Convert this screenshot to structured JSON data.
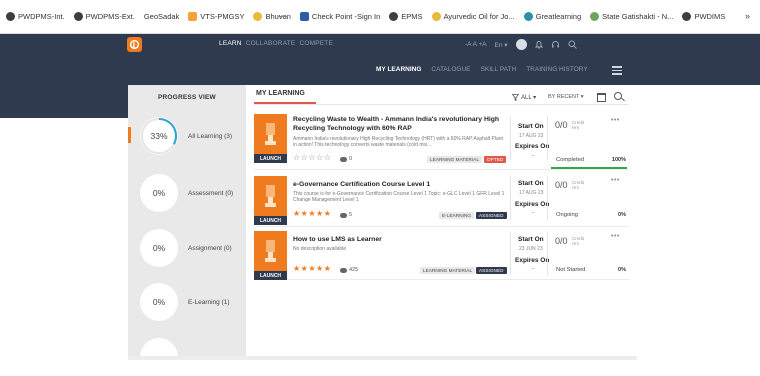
{
  "bookmarks": [
    {
      "label": "PWDPMS-Int.",
      "icon": "globe-icon"
    },
    {
      "label": "PWDPMS-Ext.",
      "icon": "globe-icon"
    },
    {
      "label": "GeoSadak",
      "icon": "dash-icon"
    },
    {
      "label": "VTS-PMGSY",
      "icon": "vts-icon"
    },
    {
      "label": "Bhuvan",
      "icon": "bhuvan-icon"
    },
    {
      "label": "Check Point -Sign In",
      "icon": "checkpoint-icon"
    },
    {
      "label": "EPMS",
      "icon": "globe-icon"
    },
    {
      "label": "Ayurvedic Oil for Jo...",
      "icon": "leaf-icon"
    },
    {
      "label": "Greatlearning",
      "icon": "g-icon"
    },
    {
      "label": "State Gatishakti - N...",
      "icon": "gatishakti-icon"
    },
    {
      "label": "PWDIMS",
      "icon": "globe-icon"
    }
  ],
  "bookmarks_more": "»",
  "topnav": {
    "learn": "LEARN",
    "collaborate": "COLLABORATE",
    "compete": "COMPETE"
  },
  "topright": {
    "font_sizes": "-A A +A",
    "lang": "En ▾"
  },
  "subnav": {
    "my_learning": "MY LEARNING",
    "catalogue": "CATALOGUE",
    "skill_path": "SKILL PATH",
    "training_history": "TRAINING HISTORY"
  },
  "progress_view": {
    "title": "PROGRESS VIEW",
    "items": [
      {
        "pct_label": "33%",
        "label": "All Learning (3)",
        "fraction": 0.33
      },
      {
        "pct_label": "0%",
        "label": "Assessment (0)",
        "fraction": 0
      },
      {
        "pct_label": "0%",
        "label": "Assignment (0)",
        "fraction": 0
      },
      {
        "pct_label": "0%",
        "label": "E-Learning (1)",
        "fraction": 0
      }
    ]
  },
  "main": {
    "title": "MY LEARNING",
    "filter_label": "ALL ▾",
    "sort_label": "BY RECENT ▾"
  },
  "courses": [
    {
      "title": "Recycling Waste to Wealth - Ammann India's revolutionary High Recycling Technology with 60% RAP",
      "desc": "Ammann India's revolutionary High Recycling Technology (HRT) with a 60% RAP Asphalt Plant in action! This technology converts waste materials (cold mix...",
      "stars_filled": 0,
      "comments": "0",
      "type_tag": "LEARNING MATERIAL",
      "status_tag": "OPTED",
      "start_label": "Start On",
      "start_date": "17 AUG 23",
      "expires_label": "Expires On",
      "expires_value": "-",
      "credit": "0/0",
      "credit_label": "Credit Hrs",
      "status": "Completed",
      "pct": "100%",
      "progress": 1.0,
      "launch": "LAUNCH"
    },
    {
      "title": "e-Governance Certification Course Level 1",
      "desc": "This course is for e-Governance Certification Course Level 1 Topic: e-GLC Level 1 GFR Level 1 Change Management Level 1",
      "stars_filled": 5,
      "comments": "5",
      "type_tag": "E-LEARNING",
      "status_tag": "ASSIGNED",
      "start_label": "Start On",
      "start_date": "17 AUG 23",
      "expires_label": "Expires On",
      "expires_value": "-",
      "credit": "0/0",
      "credit_label": "Credit Hrs",
      "status": "Ongoing",
      "pct": "0%",
      "progress": 0,
      "launch": "LAUNCH"
    },
    {
      "title": "How to use LMS as Learner",
      "desc": "No description available",
      "stars_filled": 5,
      "comments": "425",
      "type_tag": "LEARNING MATERIAL",
      "status_tag": "ASSIGNED",
      "start_label": "Start On",
      "start_date": "23 JUN 23",
      "expires_label": "Expires On",
      "expires_value": "-",
      "credit": "0/0",
      "credit_label": "Credit Hrs",
      "status": "Not Started",
      "pct": "0%",
      "progress": 0,
      "launch": "LAUNCH"
    }
  ],
  "colors": {
    "accent": "#f07a1e",
    "navy": "#2f3a4e",
    "red": "#e05a4b",
    "green": "#2eaa4a"
  }
}
